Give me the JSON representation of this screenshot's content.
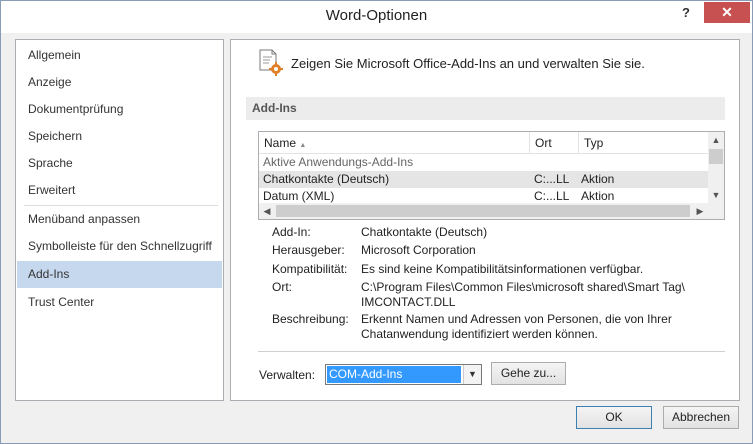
{
  "window": {
    "title": "Word-Optionen",
    "help_label": "?",
    "close_label": "✕"
  },
  "nav": {
    "items": [
      {
        "label": "Allgemein"
      },
      {
        "label": "Anzeige"
      },
      {
        "label": "Dokumentprüfung"
      },
      {
        "label": "Speichern"
      },
      {
        "label": "Sprache"
      },
      {
        "label": "Erweitert"
      },
      {
        "label": "Menüband anpassen"
      },
      {
        "label": "Symbolleiste für den Schnellzugriff"
      },
      {
        "label": "Add-Ins",
        "active": true
      },
      {
        "label": "Trust Center"
      }
    ]
  },
  "main": {
    "header": "Zeigen Sie Microsoft Office-Add-Ins an und verwalten Sie sie.",
    "section_title": "Add-Ins",
    "list": {
      "columns": [
        "Name",
        "Ort",
        "Typ"
      ],
      "group": "Aktive Anwendungs-Add-Ins",
      "rows": [
        {
          "name": "Chatkontakte (Deutsch)",
          "location": "C:...LL",
          "type": "Aktion",
          "selected": true
        },
        {
          "name": "Datum (XML)",
          "location": "C:...LL",
          "type": "Aktion",
          "selected": false
        }
      ]
    },
    "details": {
      "addin_label": "Add-In:",
      "addin_value": "Chatkontakte (Deutsch)",
      "publisher_label": "Herausgeber:",
      "publisher_value": "Microsoft Corporation",
      "compat_label": "Kompatibilität:",
      "compat_value": "Es sind keine Kompatibilitätsinformationen verfügbar.",
      "location_label": "Ort:",
      "location_value_1": "C:\\Program Files\\Common Files\\microsoft shared\\Smart Tag\\",
      "location_value_2": "IMCONTACT.DLL",
      "description_label": "Beschreibung:",
      "description_value_1": "Erkennt Namen und Adressen von Personen, die von Ihrer",
      "description_value_2": "Chatanwendung identifiziert werden können."
    },
    "manage": {
      "label": "Verwalten:",
      "selected": "COM-Add-Ins",
      "goto_label": "Gehe zu..."
    }
  },
  "footer": {
    "ok_label": "OK",
    "cancel_label": "Abbrechen"
  },
  "colors": {
    "accent": "#3399ff",
    "nav_active": "#c5d8ee",
    "close": "#c75050"
  }
}
